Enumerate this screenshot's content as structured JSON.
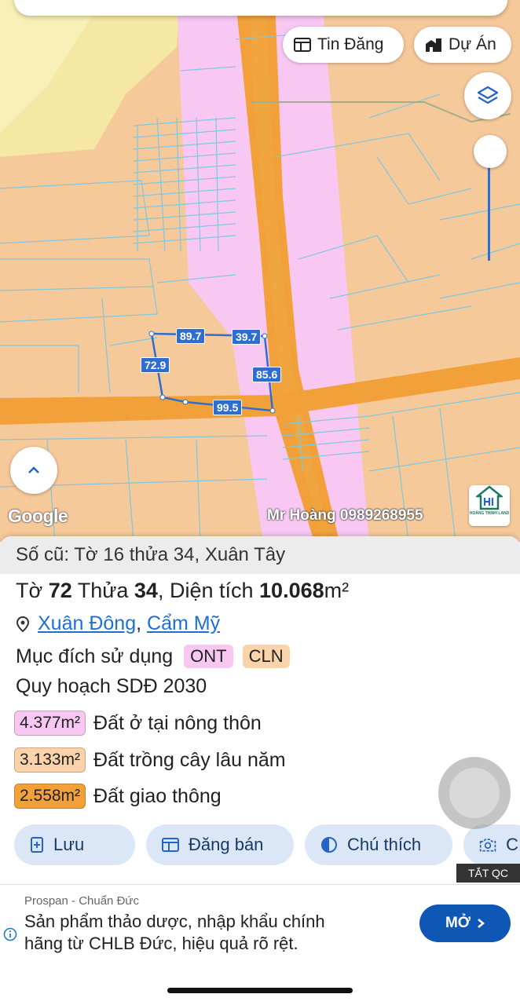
{
  "map": {
    "tin_dang_label": "Tin Đăng",
    "du_an_label": "Dự Án",
    "dimensions": [
      "89.7",
      "39.7",
      "72.9",
      "85.6",
      "99.5"
    ],
    "google_label": "Google",
    "watermark": "Mr Hoàng 0989268955",
    "logo_text": "HOÀNG THỊNH LAND",
    "colors": {
      "land": "#f6c99b",
      "residential": "#f8c8f3",
      "road": "#f2a13a",
      "parcel_line": "#7fc8de",
      "boundary": "#2f6ed1"
    }
  },
  "panel": {
    "old_info": "Số cũ: Tờ 16 thửa 34, Xuân Tây",
    "title": {
      "to_label": "Tờ",
      "to_value": "72",
      "thua_label": "Thửa",
      "thua_value": "34",
      "area_label": ", Diện tích",
      "area_value": "10.068",
      "area_unit": "m²"
    },
    "location": {
      "commune": "Xuân Đông",
      "separator": ",",
      "district": "Cẩm Mỹ"
    },
    "purpose_label": "Mục đích sử dụng",
    "purpose_codes": [
      "ONT",
      "CLN"
    ],
    "plan_label": "Quy hoạch SDĐ 2030",
    "areas": [
      {
        "value": "4.377m²",
        "label": "Đất ở tại nông thôn",
        "color": "#f8c8f3"
      },
      {
        "value": "3.133m²",
        "label": "Đất trồng cây lâu năm",
        "color": "#fbd3ab"
      },
      {
        "value": "2.558m²",
        "label": "Đất giao thông",
        "color": "#f2a13a"
      }
    ],
    "actions": [
      "Lưu",
      "Đăng bán",
      "Chú thích",
      "C"
    ]
  },
  "ad": {
    "close_label": "TẮT QC",
    "brand": "Prospan - Chuẩn Đức",
    "text_line1": "Sản phẩm thảo dược, nhập khẩu chính",
    "text_line2": "hãng từ CHLB Đức, hiệu quả rõ rệt.",
    "cta": "MỞ"
  }
}
